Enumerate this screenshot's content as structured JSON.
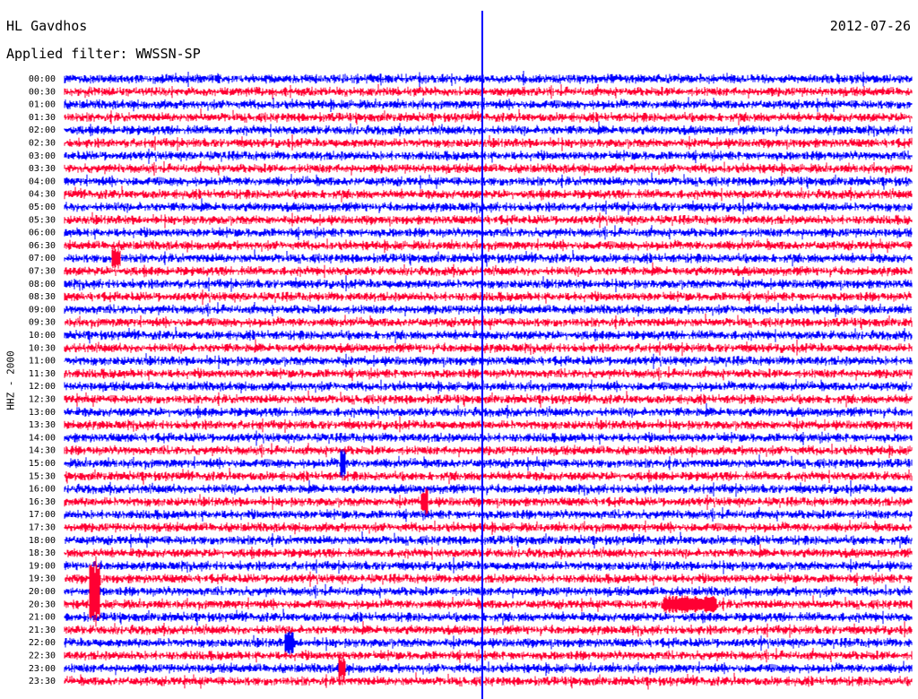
{
  "header": {
    "station": "HL Gavdhos",
    "date": "2012-07-26",
    "filter_label": "Applied filter: WWSSN-SP"
  },
  "chart_data": {
    "type": "line",
    "title": "HL Gavdhos",
    "subtitle": "Applied filter: WWSSN-SP",
    "ylabel": "HHZ - 2000",
    "categories": [
      "00:00",
      "00:30",
      "01:00",
      "01:30",
      "02:00",
      "02:30",
      "03:00",
      "03:30",
      "04:00",
      "04:30",
      "05:00",
      "05:30",
      "06:00",
      "06:30",
      "07:00",
      "07:30",
      "08:00",
      "08:30",
      "09:00",
      "09:30",
      "10:00",
      "10:30",
      "11:00",
      "11:30",
      "12:00",
      "12:30",
      "13:00",
      "13:30",
      "14:00",
      "14:30",
      "15:00",
      "15:30",
      "16:00",
      "16:30",
      "17:00",
      "17:30",
      "18:00",
      "18:30",
      "19:00",
      "19:30",
      "20:00",
      "20:30",
      "21:00",
      "21:30",
      "22:00",
      "22:30",
      "23:00",
      "23:30"
    ],
    "series": [
      {
        "color": "#0000ff"
      },
      {
        "color": "#ff0033"
      }
    ],
    "grid": false
  }
}
